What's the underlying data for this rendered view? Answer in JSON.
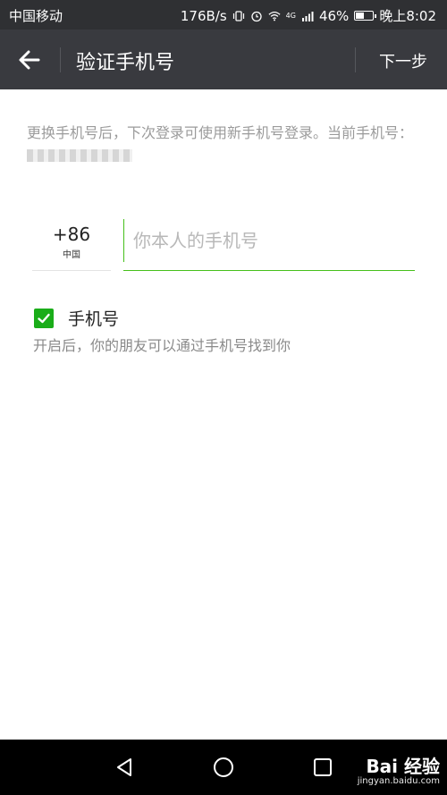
{
  "status_bar": {
    "carrier": "中国移动",
    "speed": "176B/s",
    "network": "4G",
    "battery": "46%",
    "time": "晚上8:02"
  },
  "header": {
    "title": "验证手机号",
    "next_label": "下一步"
  },
  "description": {
    "line": "更换手机号后，下次登录可使用新手机号登录。当前手机号："
  },
  "country": {
    "code": "+86",
    "name": "中国"
  },
  "phone_input": {
    "placeholder": "你本人的手机号",
    "value": ""
  },
  "option": {
    "label": "手机号",
    "description": "开启后，你的朋友可以通过手机号找到你",
    "checked": true
  },
  "watermark": {
    "logo": "Bai 经验",
    "url": "jingyan.baidu.com"
  },
  "colors": {
    "accent_green": "#45c01a",
    "checkbox_green": "#1aad19",
    "title_bar": "#393a3f",
    "status_bar": "#2f3033"
  }
}
